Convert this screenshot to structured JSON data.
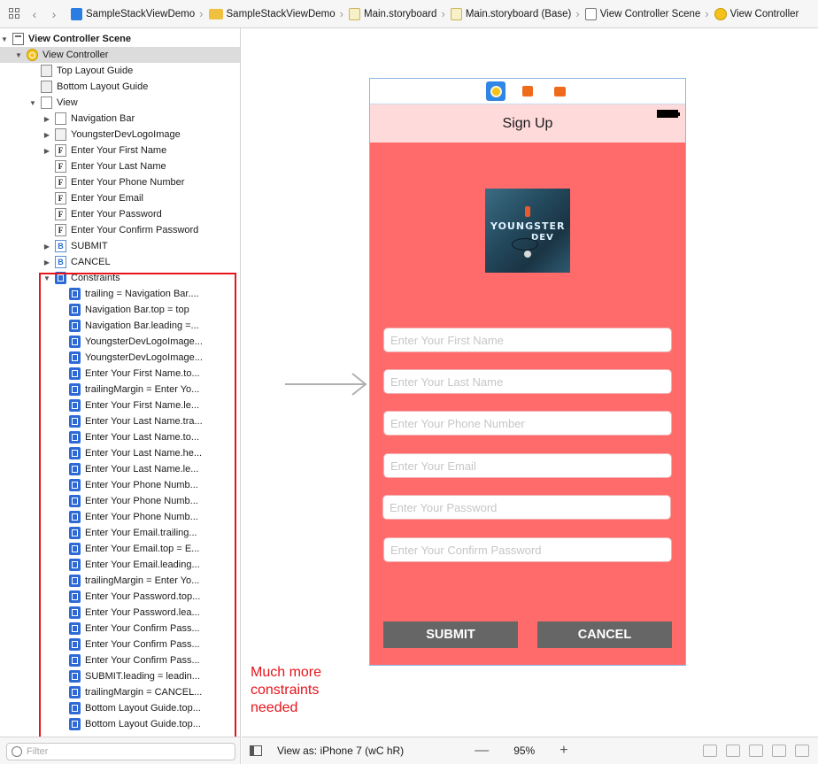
{
  "jumpbar": {
    "crumbs": [
      {
        "label": "SampleStackViewDemo",
        "icon": "project-icon"
      },
      {
        "label": "SampleStackViewDemo",
        "icon": "folder-icon"
      },
      {
        "label": "Main.storyboard",
        "icon": "storyboard-icon"
      },
      {
        "label": "Main.storyboard (Base)",
        "icon": "storyboard-icon"
      },
      {
        "label": "View Controller Scene",
        "icon": "scene-icon"
      },
      {
        "label": "View Controller",
        "icon": "view-controller-icon"
      }
    ]
  },
  "outline": {
    "rows": [
      {
        "label": "View Controller Scene",
        "indent": 0,
        "disclosure": "open",
        "icon": "scene-icon",
        "bold": true
      },
      {
        "label": "View Controller",
        "indent": 1,
        "disclosure": "open",
        "icon": "view-controller-icon",
        "selected": true
      },
      {
        "label": "Top Layout Guide",
        "indent": 2,
        "disclosure": "none",
        "icon": "layout-guide-icon"
      },
      {
        "label": "Bottom Layout Guide",
        "indent": 2,
        "disclosure": "none",
        "icon": "layout-guide-icon"
      },
      {
        "label": "View",
        "indent": 2,
        "disclosure": "open",
        "icon": "view-icon"
      },
      {
        "label": "Navigation Bar",
        "indent": 3,
        "disclosure": "closed",
        "icon": "navigation-bar-icon"
      },
      {
        "label": "YoungsterDevLogoImage",
        "indent": 3,
        "disclosure": "closed",
        "icon": "image-view-icon"
      },
      {
        "label": "Enter Your First Name",
        "indent": 3,
        "disclosure": "closed",
        "icon": "text-field-icon"
      },
      {
        "label": "Enter Your Last Name",
        "indent": 3,
        "disclosure": "none",
        "icon": "text-field-icon"
      },
      {
        "label": "Enter Your Phone Number",
        "indent": 3,
        "disclosure": "none",
        "icon": "text-field-icon"
      },
      {
        "label": "Enter Your Email",
        "indent": 3,
        "disclosure": "none",
        "icon": "text-field-icon"
      },
      {
        "label": "Enter Your Password",
        "indent": 3,
        "disclosure": "none",
        "icon": "text-field-icon"
      },
      {
        "label": "Enter Your Confirm Password",
        "indent": 3,
        "disclosure": "none",
        "icon": "text-field-icon"
      },
      {
        "label": "SUBMIT",
        "indent": 3,
        "disclosure": "closed",
        "icon": "button-icon"
      },
      {
        "label": "CANCEL",
        "indent": 3,
        "disclosure": "closed",
        "icon": "button-icon"
      },
      {
        "label": "Constraints",
        "indent": 3,
        "disclosure": "open",
        "icon": "constraints-icon"
      },
      {
        "label": "trailing = Navigation Bar....",
        "indent": 4,
        "disclosure": "none",
        "icon": "constraint-icon"
      },
      {
        "label": "Navigation Bar.top = top",
        "indent": 4,
        "disclosure": "none",
        "icon": "constraint-icon"
      },
      {
        "label": "Navigation Bar.leading =...",
        "indent": 4,
        "disclosure": "none",
        "icon": "constraint-icon"
      },
      {
        "label": "YoungsterDevLogoImage...",
        "indent": 4,
        "disclosure": "none",
        "icon": "constraint-icon"
      },
      {
        "label": "YoungsterDevLogoImage...",
        "indent": 4,
        "disclosure": "none",
        "icon": "constraint-icon"
      },
      {
        "label": "Enter Your First Name.to...",
        "indent": 4,
        "disclosure": "none",
        "icon": "constraint-icon"
      },
      {
        "label": "trailingMargin = Enter Yo...",
        "indent": 4,
        "disclosure": "none",
        "icon": "constraint-icon"
      },
      {
        "label": "Enter Your First Name.le...",
        "indent": 4,
        "disclosure": "none",
        "icon": "constraint-icon"
      },
      {
        "label": "Enter Your Last Name.tra...",
        "indent": 4,
        "disclosure": "none",
        "icon": "constraint-icon"
      },
      {
        "label": "Enter Your Last Name.to...",
        "indent": 4,
        "disclosure": "none",
        "icon": "constraint-icon"
      },
      {
        "label": "Enter Your Last Name.he...",
        "indent": 4,
        "disclosure": "none",
        "icon": "constraint-icon"
      },
      {
        "label": "Enter Your Last Name.le...",
        "indent": 4,
        "disclosure": "none",
        "icon": "constraint-icon"
      },
      {
        "label": "Enter Your Phone Numb...",
        "indent": 4,
        "disclosure": "none",
        "icon": "constraint-icon"
      },
      {
        "label": "Enter Your Phone Numb...",
        "indent": 4,
        "disclosure": "none",
        "icon": "constraint-icon"
      },
      {
        "label": "Enter Your Phone Numb...",
        "indent": 4,
        "disclosure": "none",
        "icon": "constraint-icon"
      },
      {
        "label": "Enter Your Email.trailing...",
        "indent": 4,
        "disclosure": "none",
        "icon": "constraint-icon"
      },
      {
        "label": "Enter Your Email.top = E...",
        "indent": 4,
        "disclosure": "none",
        "icon": "constraint-icon"
      },
      {
        "label": "Enter Your Email.leading...",
        "indent": 4,
        "disclosure": "none",
        "icon": "constraint-icon"
      },
      {
        "label": "trailingMargin = Enter Yo...",
        "indent": 4,
        "disclosure": "none",
        "icon": "constraint-icon"
      },
      {
        "label": "Enter Your Password.top...",
        "indent": 4,
        "disclosure": "none",
        "icon": "constraint-icon"
      },
      {
        "label": "Enter Your Password.lea...",
        "indent": 4,
        "disclosure": "none",
        "icon": "constraint-icon"
      },
      {
        "label": "Enter Your Confirm Pass...",
        "indent": 4,
        "disclosure": "none",
        "icon": "constraint-icon"
      },
      {
        "label": "Enter Your Confirm Pass...",
        "indent": 4,
        "disclosure": "none",
        "icon": "constraint-icon"
      },
      {
        "label": "Enter Your Confirm Pass...",
        "indent": 4,
        "disclosure": "none",
        "icon": "constraint-icon"
      },
      {
        "label": "SUBMIT.leading = leadin...",
        "indent": 4,
        "disclosure": "none",
        "icon": "constraint-icon"
      },
      {
        "label": "trailingMargin = CANCEL...",
        "indent": 4,
        "disclosure": "none",
        "icon": "constraint-icon"
      },
      {
        "label": "Bottom Layout Guide.top...",
        "indent": 4,
        "disclosure": "none",
        "icon": "constraint-icon"
      },
      {
        "label": "Bottom Layout Guide.top...",
        "indent": 4,
        "disclosure": "none",
        "icon": "constraint-icon"
      }
    ]
  },
  "filter": {
    "placeholder": "Filter"
  },
  "device": {
    "nav_title": "Sign Up",
    "logo_text_1": "YOUNGSTER",
    "logo_text_2": "DEV",
    "fields": [
      {
        "placeholder": "Enter Your First Name"
      },
      {
        "placeholder": "Enter Your Last Name"
      },
      {
        "placeholder": "Enter Your Phone Number"
      },
      {
        "placeholder": "Enter Your Email"
      },
      {
        "placeholder": "Enter Your Password"
      },
      {
        "placeholder": "Enter Your Confirm Password"
      }
    ],
    "submit_label": "SUBMIT",
    "cancel_label": "CANCEL",
    "background_color": "#ff6b6b",
    "navbar_color": "#ffdada",
    "button_color": "#666666"
  },
  "annotation": {
    "text_lines": [
      "Much more",
      "constraints",
      "needed"
    ],
    "color": "#e8141c"
  },
  "bottombar": {
    "view_as": "View as: iPhone 7 (wC hR)",
    "minus": "—",
    "zoom": "95%",
    "plus": "+"
  }
}
